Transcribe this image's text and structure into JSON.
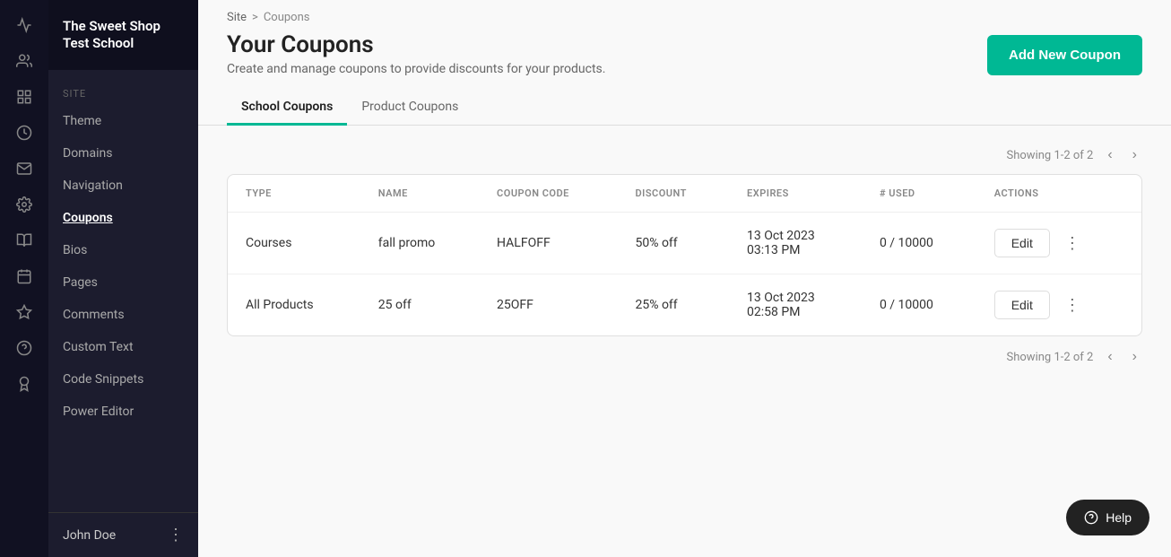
{
  "sidebar": {
    "logo": "The Sweet Shop Test School",
    "section_label": "SITE",
    "items": [
      {
        "id": "theme",
        "label": "Theme",
        "active": false
      },
      {
        "id": "domains",
        "label": "Domains",
        "active": false
      },
      {
        "id": "navigation",
        "label": "Navigation",
        "active": false
      },
      {
        "id": "coupons",
        "label": "Coupons",
        "active": true
      },
      {
        "id": "bios",
        "label": "Bios",
        "active": false
      },
      {
        "id": "pages",
        "label": "Pages",
        "active": false
      },
      {
        "id": "comments",
        "label": "Comments",
        "active": false
      },
      {
        "id": "custom-text",
        "label": "Custom Text",
        "active": false
      },
      {
        "id": "code-snippets",
        "label": "Code Snippets",
        "active": false
      },
      {
        "id": "power-editor",
        "label": "Power Editor",
        "active": false
      }
    ],
    "footer": {
      "user": "John Doe"
    }
  },
  "breadcrumb": {
    "site": "Site",
    "separator": ">",
    "current": "Coupons"
  },
  "page": {
    "title": "Your Coupons",
    "subtitle": "Create and manage coupons to provide discounts for your products.",
    "add_button": "Add New Coupon"
  },
  "tabs": [
    {
      "id": "school-coupons",
      "label": "School Coupons",
      "active": true
    },
    {
      "id": "product-coupons",
      "label": "Product Coupons",
      "active": false
    }
  ],
  "table": {
    "showing_label": "Showing 1-2 of 2",
    "columns": [
      "TYPE",
      "NAME",
      "COUPON CODE",
      "DISCOUNT",
      "EXPIRES",
      "# USED",
      "ACTIONS"
    ],
    "rows": [
      {
        "type": "Courses",
        "name": "fall promo",
        "coupon_code": "HALFOFF",
        "discount": "50% off",
        "expires": "13 Oct 2023\n03:13 PM",
        "expires_line1": "13 Oct 2023",
        "expires_line2": "03:13 PM",
        "used": "0 / 10000",
        "edit_label": "Edit"
      },
      {
        "type": "All Products",
        "name": "25 off",
        "coupon_code": "25OFF",
        "discount": "25% off",
        "expires": "13 Oct 2023\n02:58 PM",
        "expires_line1": "13 Oct 2023",
        "expires_line2": "02:58 PM",
        "used": "0 / 10000",
        "edit_label": "Edit"
      }
    ],
    "bottom_showing": "Showing 1-2 of 2"
  },
  "help": {
    "label": "Help"
  },
  "icons": {
    "analytics": "📊",
    "users": "👥",
    "dashboard": "▦",
    "revenue": "💰",
    "mail": "✉",
    "settings": "⚙",
    "library": "📚",
    "calendar": "📅",
    "integrations": "⬡",
    "support": "❓",
    "certificate": "🎓",
    "chevron_left": "‹",
    "chevron_right": "›",
    "more_vertical": "⋮",
    "help_circle": "?"
  }
}
